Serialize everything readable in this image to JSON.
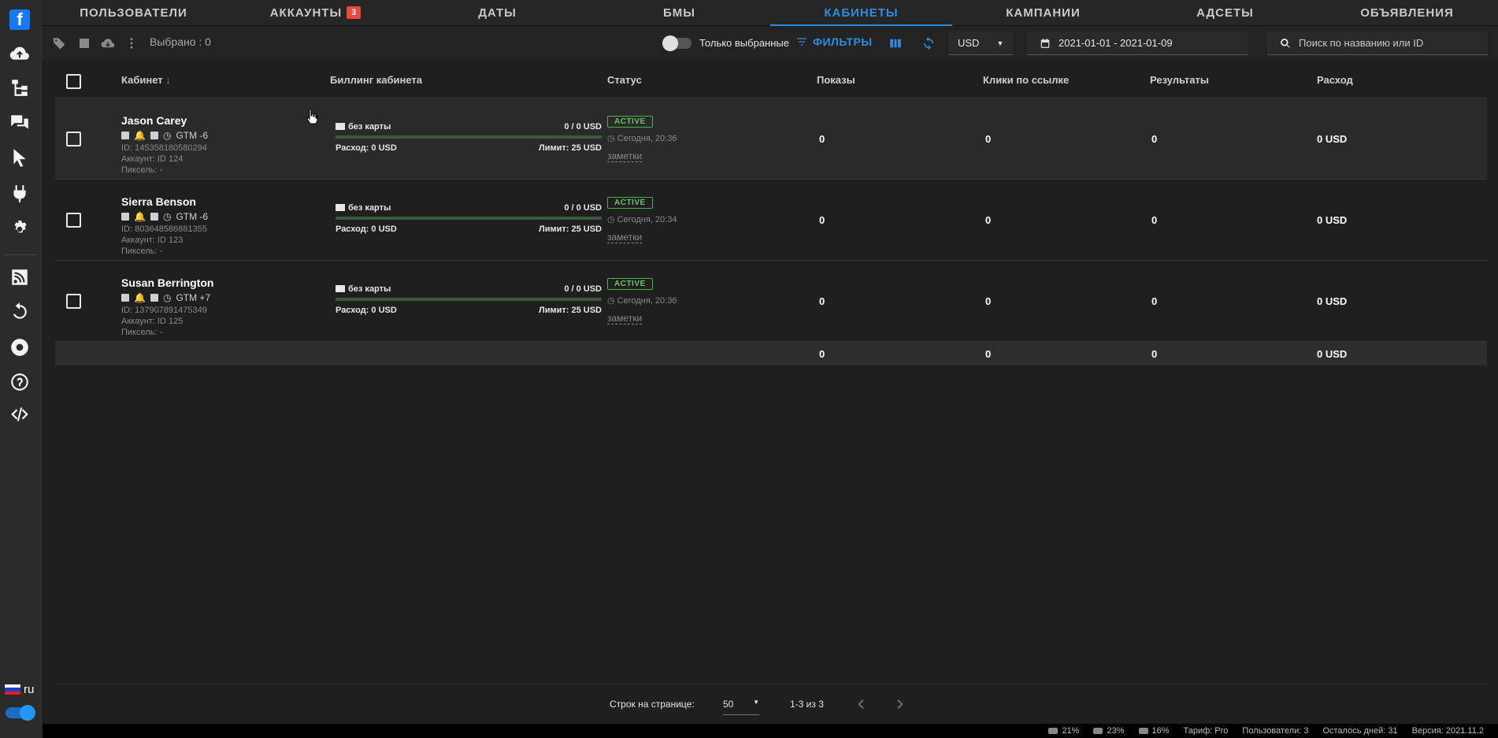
{
  "colors": {
    "accent": "#2e8de0",
    "badge": "#e8483d",
    "active": "#4caf50",
    "background": "#1f1f1f"
  },
  "sidebar": {
    "items": [
      {
        "name": "facebook-logo",
        "icon": "facebook-icon"
      },
      {
        "name": "upload",
        "icon": "cloud-upload-icon"
      },
      {
        "name": "structure",
        "icon": "sitemap-icon"
      },
      {
        "name": "chat",
        "icon": "comments-icon"
      },
      {
        "name": "pointer",
        "icon": "cursor-icon"
      },
      {
        "name": "plugin",
        "icon": "plug-icon"
      },
      {
        "name": "settings",
        "icon": "gear-icon"
      },
      {
        "name": "rss",
        "icon": "rss-icon"
      },
      {
        "name": "history",
        "icon": "undo-icon"
      },
      {
        "name": "chrome",
        "icon": "chrome-icon"
      },
      {
        "name": "help",
        "icon": "question-icon"
      },
      {
        "name": "code",
        "icon": "code-icon"
      }
    ],
    "lang": "ru"
  },
  "tabs": [
    {
      "label": "ПОЛЬЗОВАТЕЛИ"
    },
    {
      "label": "АККАУНТЫ",
      "badge": "3"
    },
    {
      "label": "ДАТЫ"
    },
    {
      "label": "БМЫ"
    },
    {
      "label": "КАБИНЕТЫ",
      "active": true
    },
    {
      "label": "КАМПАНИИ"
    },
    {
      "label": "АДСЕТЫ"
    },
    {
      "label": "ОБЪЯВЛЕНИЯ"
    }
  ],
  "toolbar": {
    "selected": "Выбрано : 0",
    "only_selected": "Только выбранные",
    "filters": "ФИЛЬТРЫ",
    "currency": "USD",
    "date_range": "2021-01-01 - 2021-01-09",
    "search_placeholder": "Поиск по названию или ID"
  },
  "table": {
    "headers": {
      "cabinet": "Кабинет",
      "billing": "Биллинг кабинета",
      "status": "Статус",
      "impressions": "Показы",
      "clicks": "Клики по ссылке",
      "results": "Результаты",
      "spend": "Расход"
    },
    "rows": [
      {
        "name": "Jason Carey",
        "tz": "GTM -6",
        "id": "ID: 145358180580294",
        "account": "Аккаунт: ID 124",
        "pixel": "Пиксель: -",
        "card": "без карты",
        "balance": "0 / 0 USD",
        "spent": "Расход: 0 USD",
        "limit": "Лимит: 25 USD",
        "status": "ACTIVE",
        "time": "Сегодня, 20:36",
        "notes": "заметки",
        "impressions": "0",
        "clicks": "0",
        "results": "0",
        "spend": "0 USD"
      },
      {
        "name": "Sierra Benson",
        "tz": "GTM -6",
        "id": "ID: 803648586881355",
        "account": "Аккаунт: ID 123",
        "pixel": "Пиксель: -",
        "card": "без карты",
        "balance": "0 / 0 USD",
        "spent": "Расход: 0 USD",
        "limit": "Лимит: 25 USD",
        "status": "ACTIVE",
        "time": "Сегодня, 20:34",
        "notes": "заметки",
        "impressions": "0",
        "clicks": "0",
        "results": "0",
        "spend": "0 USD"
      },
      {
        "name": "Susan Berrington",
        "tz": "GTM +7",
        "id": "ID: 137907891475349",
        "account": "Аккаунт: ID 125",
        "pixel": "Пиксель: -",
        "card": "без карты",
        "balance": "0 / 0 USD",
        "spent": "Расход: 0 USD",
        "limit": "Лимит: 25 USD",
        "status": "ACTIVE",
        "time": "Сегодня, 20:36",
        "notes": "заметки",
        "impressions": "0",
        "clicks": "0",
        "results": "0",
        "spend": "0 USD"
      }
    ],
    "totals": {
      "impressions": "0",
      "clicks": "0",
      "results": "0",
      "spend": "0 USD"
    }
  },
  "pager": {
    "rows_label": "Строк на странице:",
    "rows_value": "50",
    "range": "1-3 из 3"
  },
  "statusbar": {
    "cpu": "21%",
    "ram": "23%",
    "disk": "16%",
    "plan": "Тариф: Pro",
    "users": "Пользователи: 3",
    "days_left": "Осталось дней: 31",
    "version": "Версия: 2021.11.2"
  }
}
